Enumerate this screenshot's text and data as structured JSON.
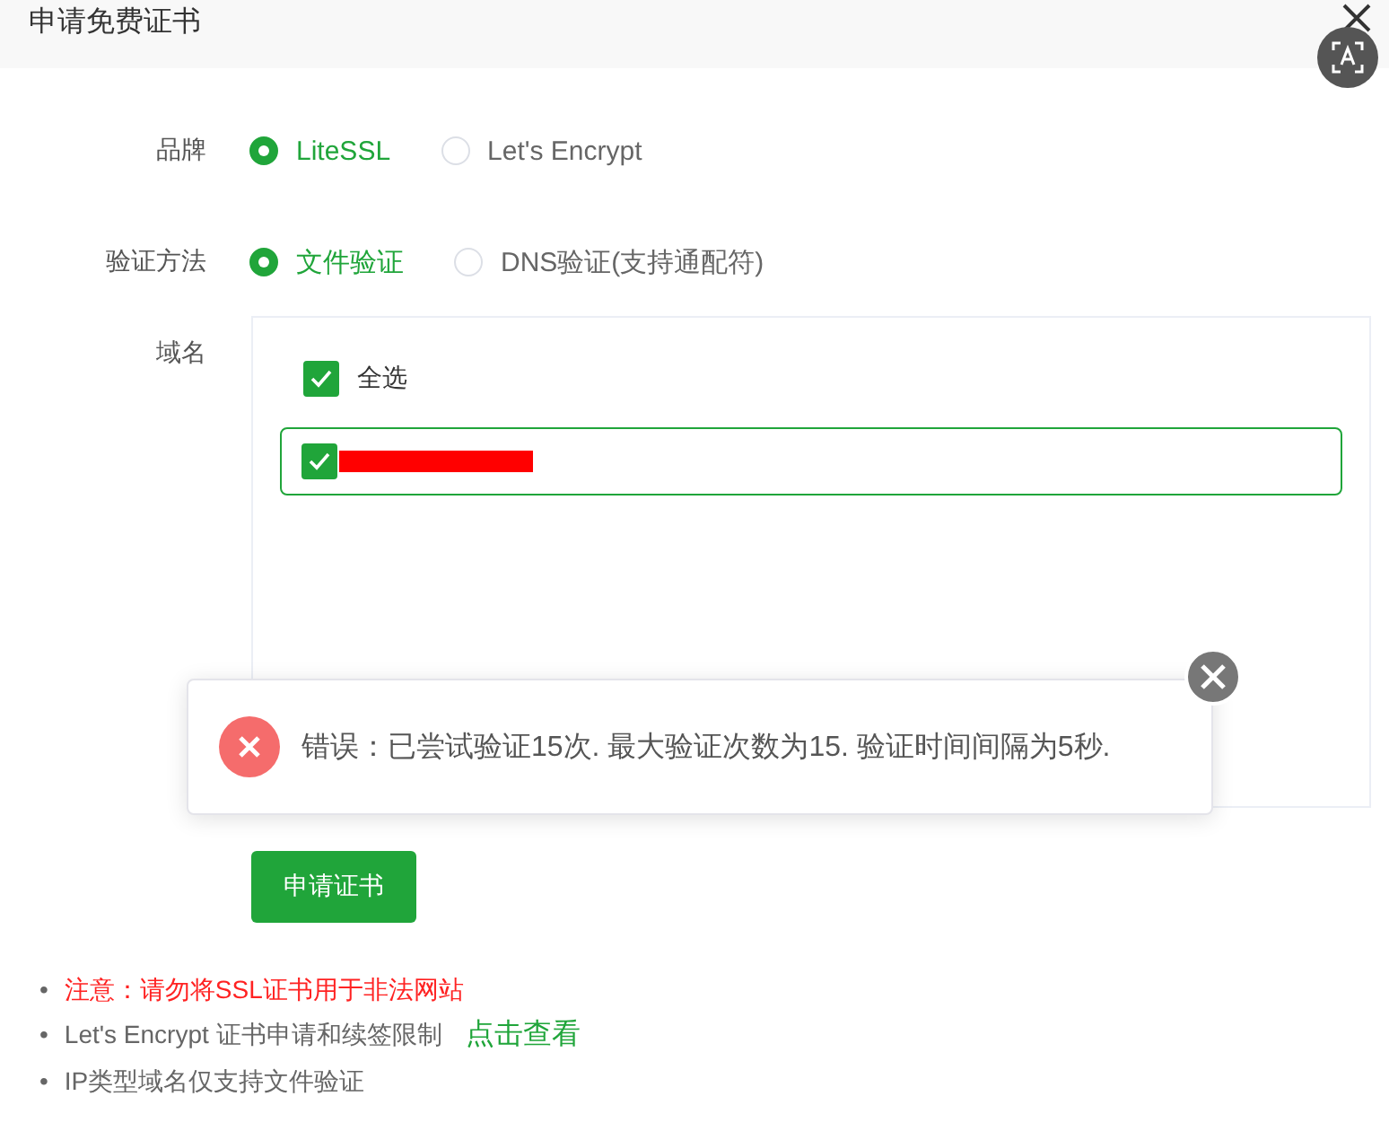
{
  "dialog": {
    "title": "申请免费证书"
  },
  "form": {
    "brand": {
      "label": "品牌",
      "options": [
        {
          "label": "LiteSSL",
          "selected": true
        },
        {
          "label": "Let's Encrypt",
          "selected": false
        }
      ]
    },
    "method": {
      "label": "验证方法",
      "options": [
        {
          "label": "文件验证",
          "selected": true
        },
        {
          "label": "DNS验证(支持通配符)",
          "selected": false
        }
      ]
    },
    "domains": {
      "label": "域名",
      "select_all": {
        "label": "全选",
        "checked": true
      },
      "items": [
        {
          "checked": true,
          "redacted": true
        }
      ]
    }
  },
  "toast": {
    "kind": "error",
    "message": "错误：已尝试验证15次. 最大验证次数为15. 验证时间间隔为5秒."
  },
  "submit": "申请证书",
  "notes": [
    {
      "bullet": "•",
      "kind": "warning",
      "text": "注意：请勿将SSL证书用于非法网站"
    },
    {
      "bullet": "•",
      "kind": "link",
      "text": "Let's Encrypt 证书申请和续签限制",
      "link": "点击查看"
    },
    {
      "bullet": "•",
      "kind": "plain",
      "text": "IP类型域名仅支持文件验证"
    }
  ]
}
